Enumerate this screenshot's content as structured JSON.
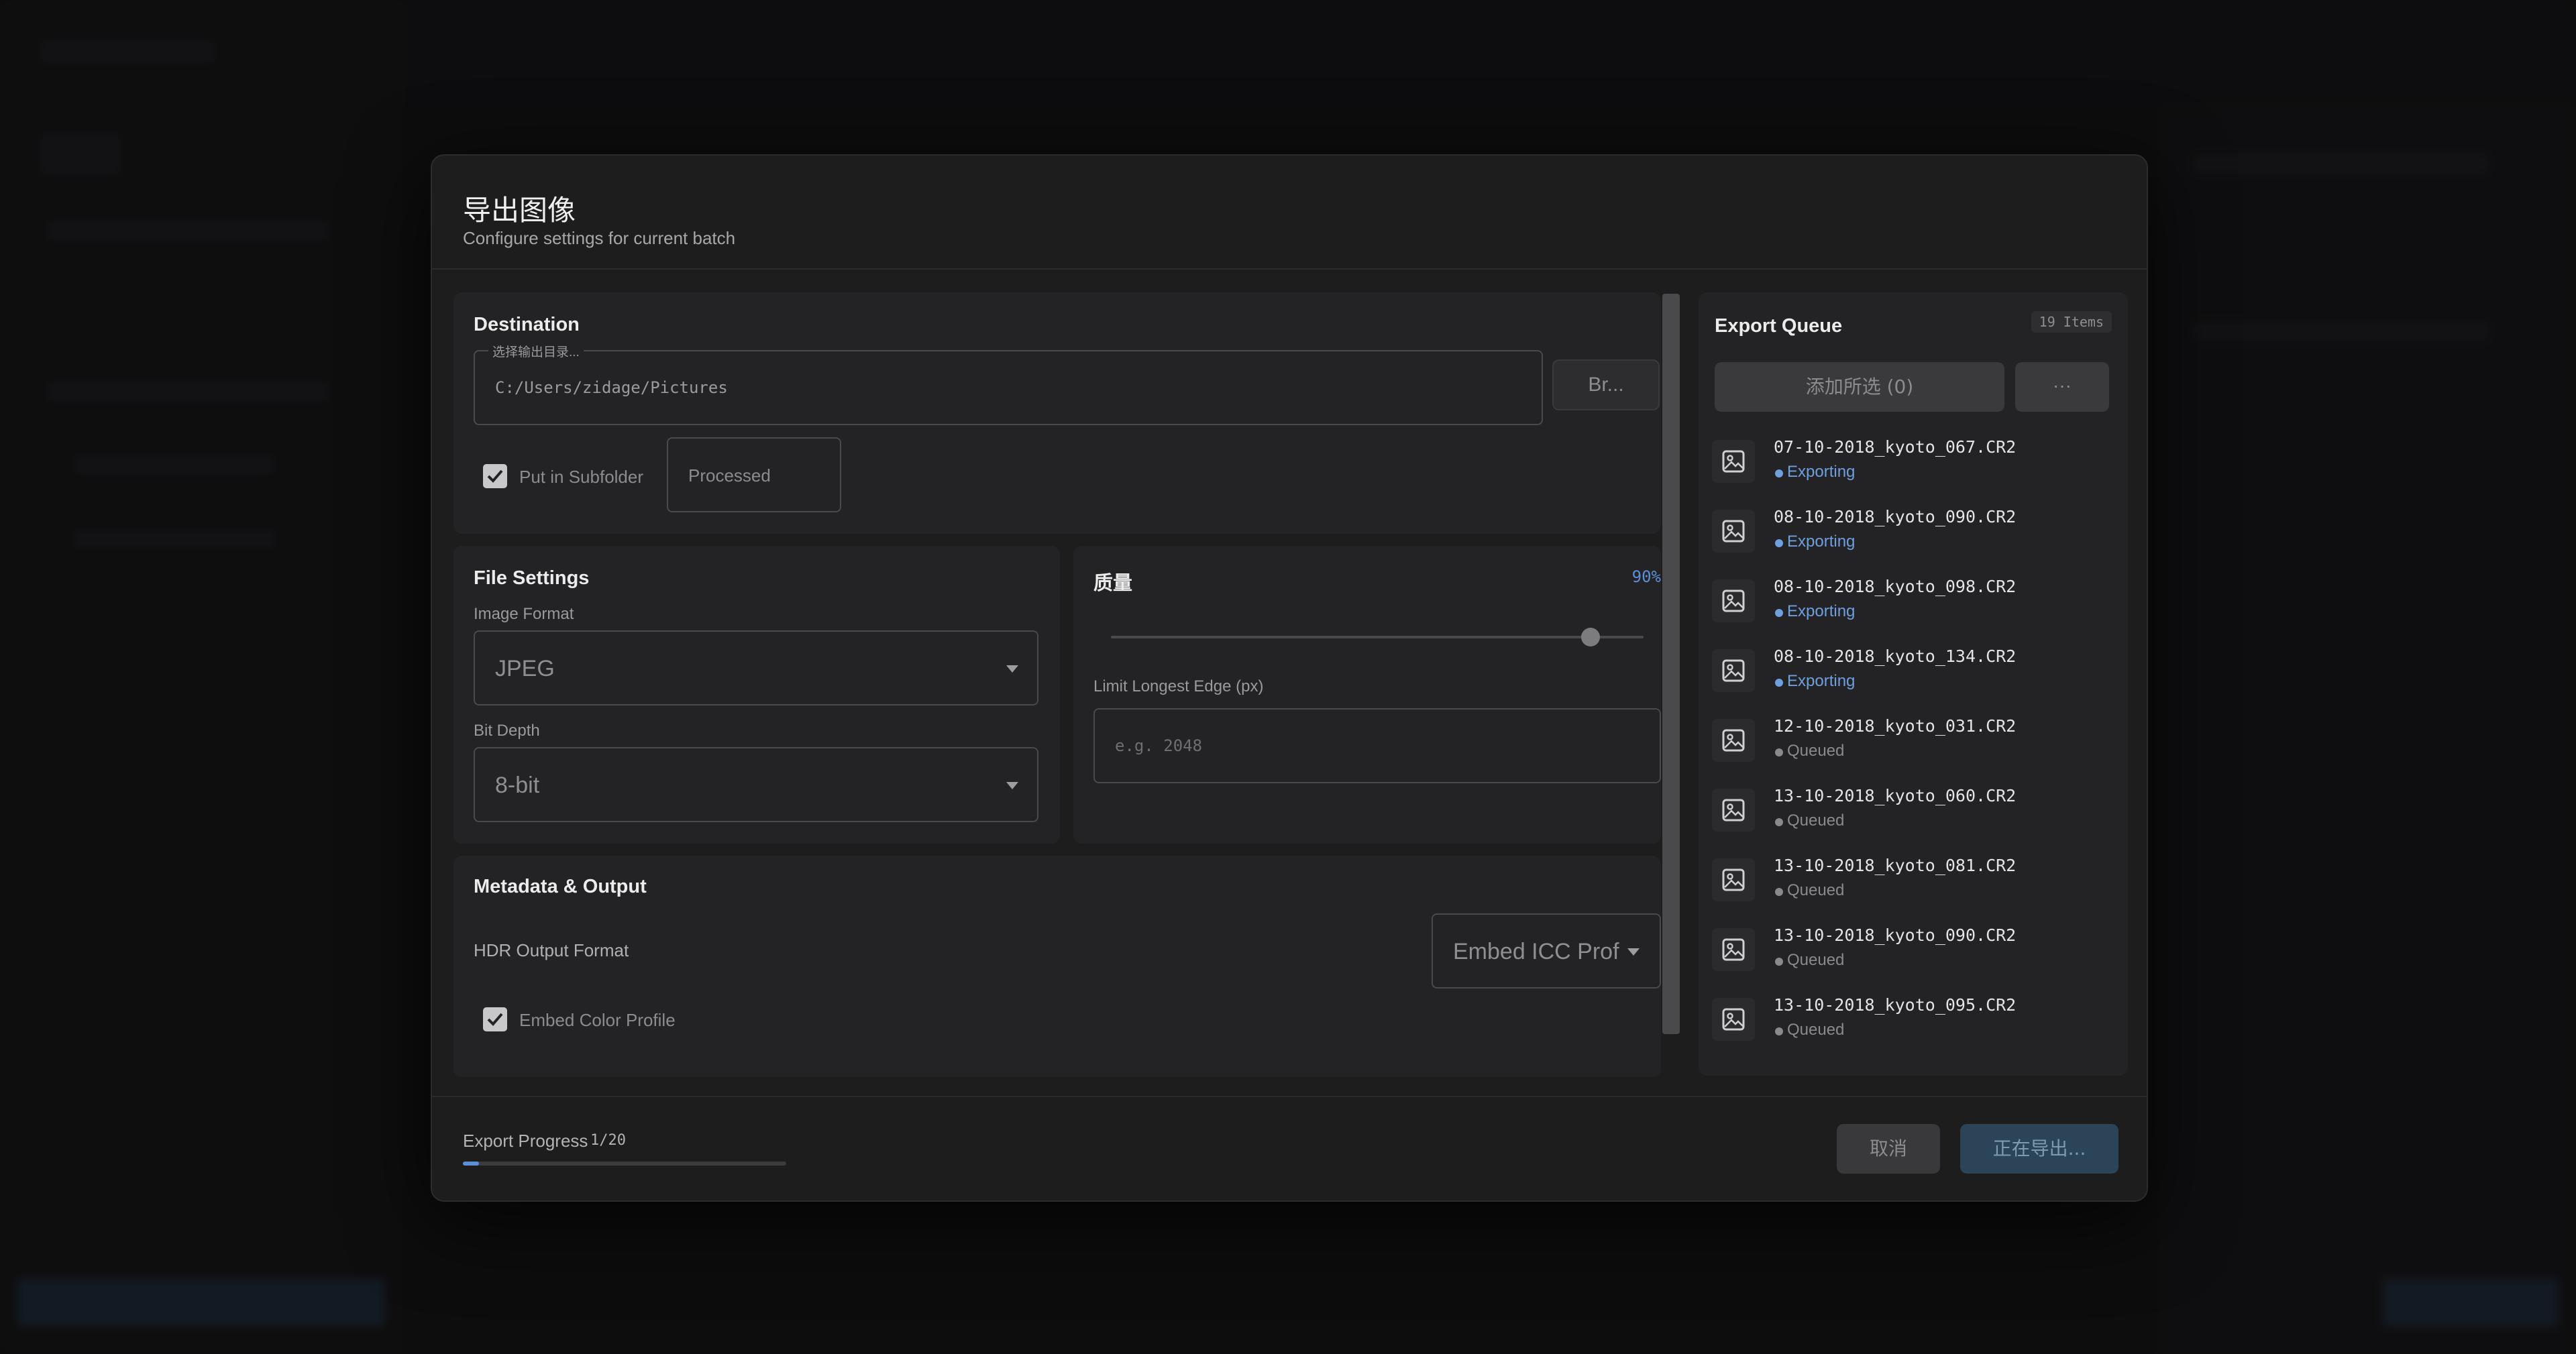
{
  "dialog": {
    "title": "导出图像",
    "subtitle": "Configure settings for current batch"
  },
  "destination": {
    "title": "Destination",
    "path_legend": "选择输出目录...",
    "path_value": "C:/Users/zidage/Pictures",
    "browse_label": "Br...",
    "subfolder_checked": true,
    "subfolder_label": "Put in Subfolder",
    "subfolder_value": "Processed"
  },
  "file_settings": {
    "title": "File Settings",
    "format_label": "Image Format",
    "format_value": "JPEG",
    "bitdepth_label": "Bit Depth",
    "bitdepth_value": "8-bit"
  },
  "quality": {
    "title": "质量",
    "value_text": "90%",
    "value": 0.9,
    "limit_label": "Limit Longest Edge (px)",
    "limit_placeholder": "e.g. 2048"
  },
  "metadata": {
    "title": "Metadata & Output",
    "hdr_label": "HDR Output Format",
    "hdr_select_value": "Embed ICC Prof",
    "embed_checked": true,
    "embed_label": "Embed Color Profile"
  },
  "queue": {
    "title": "Export Queue",
    "count_badge": "19 Items",
    "add_label": "添加所选 (0)",
    "more_label": "···",
    "items": [
      {
        "name": "07-10-2018_kyoto_067.CR2",
        "status": "Exporting"
      },
      {
        "name": "08-10-2018_kyoto_090.CR2",
        "status": "Exporting"
      },
      {
        "name": "08-10-2018_kyoto_098.CR2",
        "status": "Exporting"
      },
      {
        "name": "08-10-2018_kyoto_134.CR2",
        "status": "Exporting"
      },
      {
        "name": "12-10-2018_kyoto_031.CR2",
        "status": "Queued"
      },
      {
        "name": "13-10-2018_kyoto_060.CR2",
        "status": "Queued"
      },
      {
        "name": "13-10-2018_kyoto_081.CR2",
        "status": "Queued"
      },
      {
        "name": "13-10-2018_kyoto_090.CR2",
        "status": "Queued"
      },
      {
        "name": "13-10-2018_kyoto_095.CR2",
        "status": "Queued"
      }
    ]
  },
  "footer": {
    "progress_label": "Export Progress",
    "progress_text": "1/20",
    "progress_fraction": 0.05,
    "cancel_label": "取消",
    "export_label": "正在导出..."
  },
  "colors": {
    "accent": "#5b8fd6",
    "exporting": "#6ea0e0",
    "queued": "#8a8a8c",
    "export_button": "#2c4458"
  }
}
